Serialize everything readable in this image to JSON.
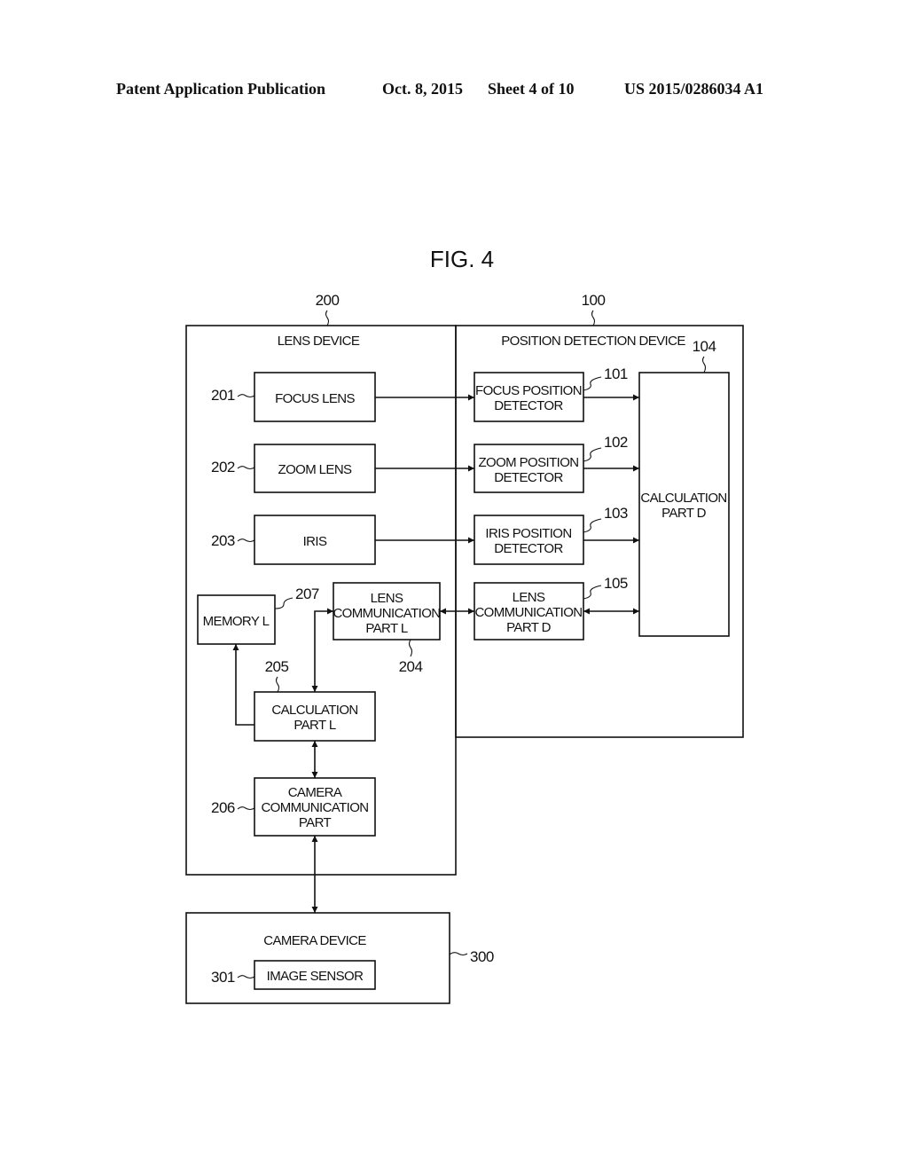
{
  "header": {
    "publication": "Patent Application Publication",
    "date": "Oct. 8, 2015",
    "sheet": "Sheet 4 of 10",
    "number": "US 2015/0286034 A1"
  },
  "figure": {
    "title": "FIG. 4",
    "lens_device": {
      "ref": "200",
      "label": "LENS DEVICE",
      "focus_lens": {
        "ref": "201",
        "label": "FOCUS LENS"
      },
      "zoom_lens": {
        "ref": "202",
        "label": "ZOOM LENS"
      },
      "iris": {
        "ref": "203",
        "label": "IRIS"
      },
      "lens_comm_l": {
        "ref": "204",
        "lines": [
          "LENS",
          "COMMUNICATION",
          "PART L"
        ]
      },
      "calc_l": {
        "ref": "205",
        "lines": [
          "CALCULATION",
          "PART L"
        ]
      },
      "camera_comm": {
        "ref": "206",
        "lines": [
          "CAMERA",
          "COMMUNICATION",
          "PART"
        ]
      },
      "memory_l": {
        "ref": "207",
        "label": "MEMORY L"
      }
    },
    "position_device": {
      "ref": "100",
      "label": "POSITION DETECTION DEVICE",
      "focus_det": {
        "ref": "101",
        "lines": [
          "FOCUS POSITION",
          "DETECTOR"
        ]
      },
      "zoom_det": {
        "ref": "102",
        "lines": [
          "ZOOM POSITION",
          "DETECTOR"
        ]
      },
      "iris_det": {
        "ref": "103",
        "lines": [
          "IRIS POSITION",
          "DETECTOR"
        ]
      },
      "calc_d": {
        "ref": "104",
        "lines": [
          "CALCULATION",
          "PART D"
        ]
      },
      "lens_comm_d": {
        "ref": "105",
        "lines": [
          "LENS",
          "COMMUNICATION",
          "PART D"
        ]
      }
    },
    "camera_device": {
      "ref": "300",
      "label": "CAMERA DEVICE",
      "image_sensor": {
        "ref": "301",
        "label": "IMAGE SENSOR"
      }
    }
  }
}
